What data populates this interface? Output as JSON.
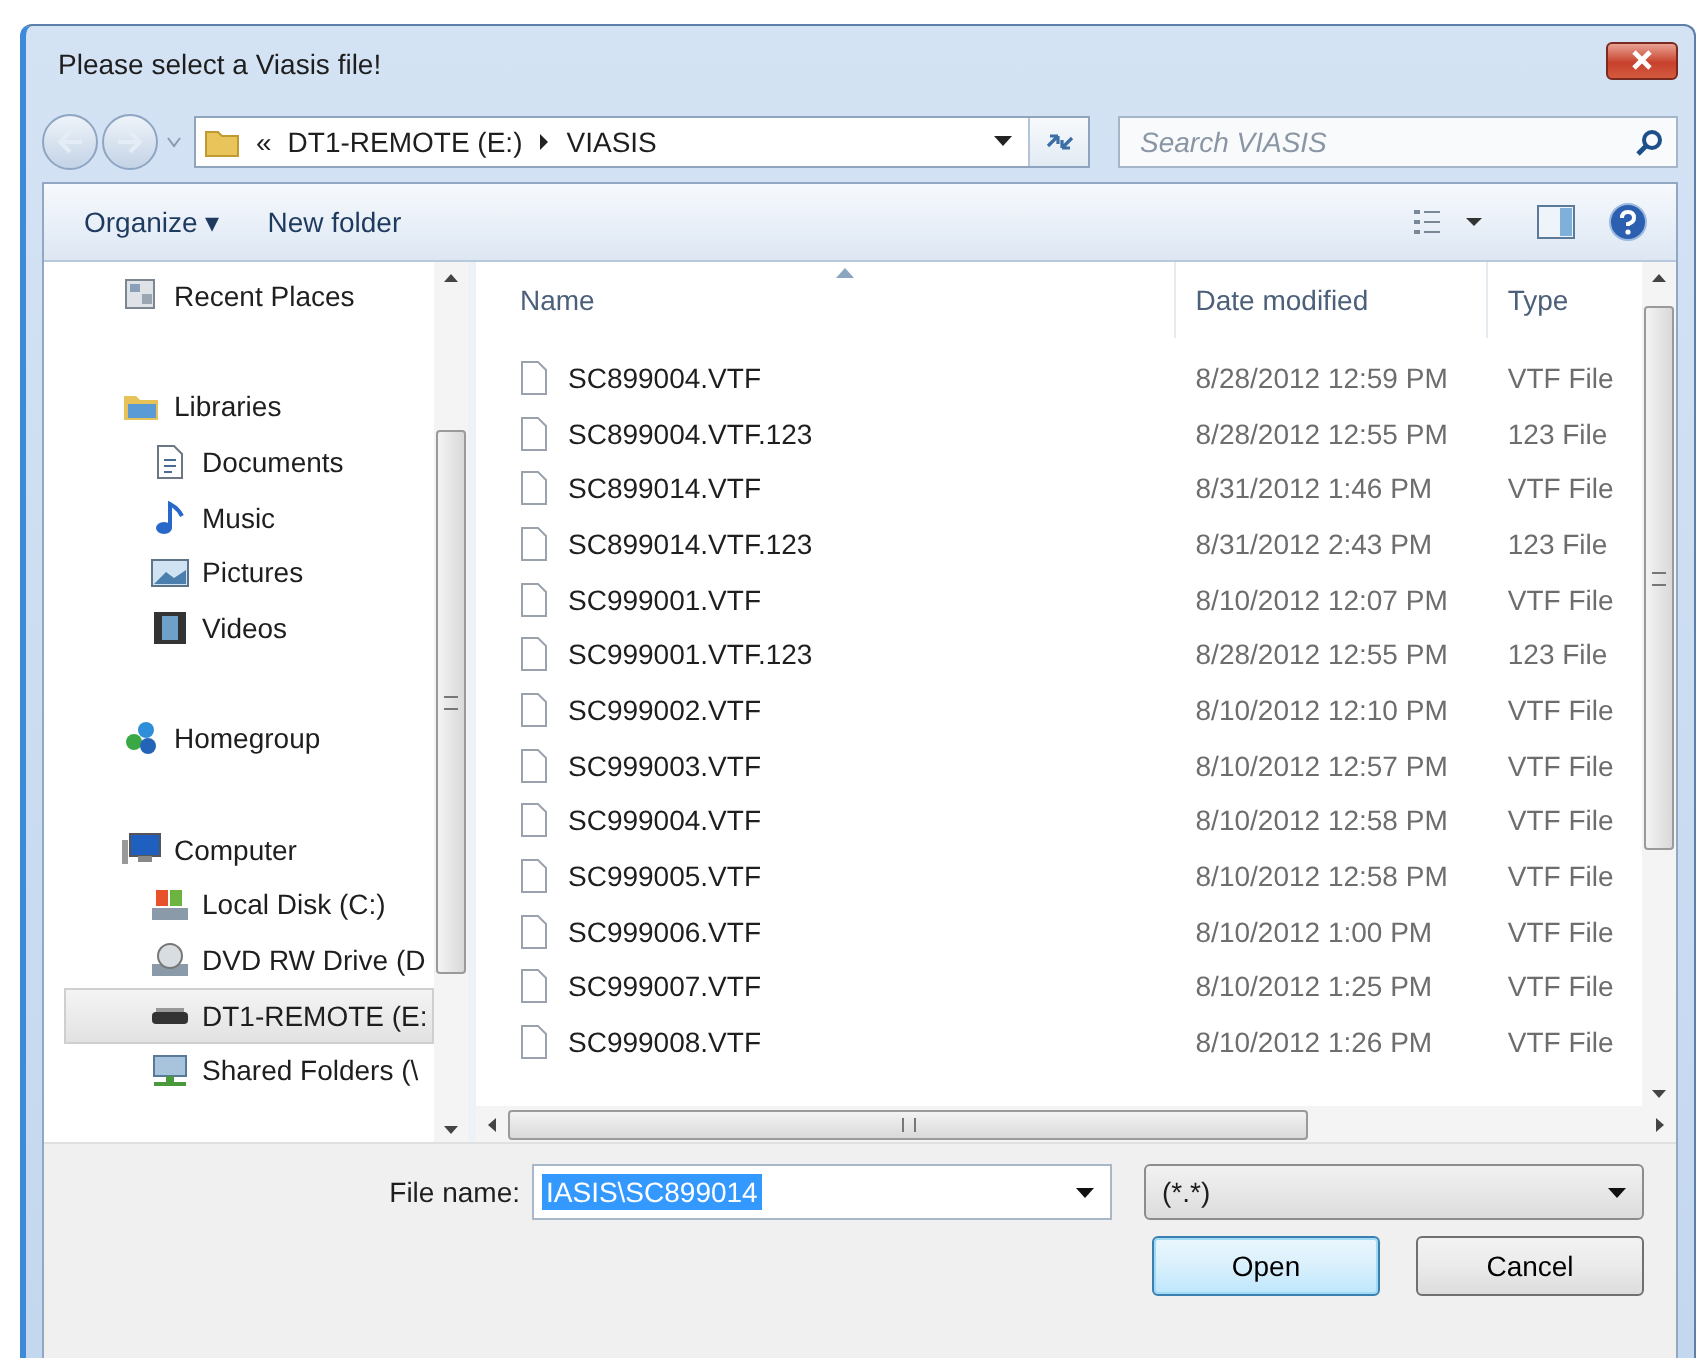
{
  "window": {
    "title": "Please select a Viasis file!"
  },
  "address": {
    "crumbs": [
      "«",
      "DT1-REMOTE (E:)",
      "VIASIS"
    ]
  },
  "search": {
    "placeholder": "Search VIASIS"
  },
  "toolbar": {
    "items": [
      "Organize ▾",
      "New folder"
    ]
  },
  "sidebar": {
    "items": [
      {
        "label": "Recent Places",
        "kind": "recent",
        "selected": false
      },
      {
        "label": "Libraries",
        "kind": "library",
        "selected": false,
        "children": [
          {
            "label": "Documents",
            "kind": "document",
            "selected": false
          },
          {
            "label": "Music",
            "kind": "music",
            "selected": false
          },
          {
            "label": "Pictures",
            "kind": "pictures",
            "selected": false
          },
          {
            "label": "Videos",
            "kind": "videos",
            "selected": false
          }
        ]
      },
      {
        "label": "Homegroup",
        "kind": "homegroup",
        "selected": false
      },
      {
        "label": "Computer",
        "kind": "computer",
        "selected": false,
        "children": [
          {
            "label": "Local Disk (C:)",
            "kind": "disk",
            "selected": false
          },
          {
            "label": "DVD RW Drive (D",
            "kind": "dvd",
            "selected": false
          },
          {
            "label": "DT1-REMOTE (E:",
            "kind": "drive",
            "selected": true
          },
          {
            "label": "Shared Folders (\\",
            "kind": "share",
            "selected": false
          }
        ]
      }
    ]
  },
  "table": {
    "columns": [
      {
        "label": "Name",
        "sorted": true
      },
      {
        "label": "Date modified",
        "sorted": false
      },
      {
        "label": "Type",
        "sorted": false
      }
    ],
    "rows": [
      {
        "name": "SC899004.VTF",
        "date": "8/28/2012 12:59 PM",
        "type": "VTF File"
      },
      {
        "name": "SC899004.VTF.123",
        "date": "8/28/2012 12:55 PM",
        "type": "123 File"
      },
      {
        "name": "SC899014.VTF",
        "date": "8/31/2012 1:46 PM",
        "type": "VTF File"
      },
      {
        "name": "SC899014.VTF.123",
        "date": "8/31/2012 2:43 PM",
        "type": "123 File"
      },
      {
        "name": "SC999001.VTF",
        "date": "8/10/2012 12:07 PM",
        "type": "VTF File"
      },
      {
        "name": "SC999001.VTF.123",
        "date": "8/28/2012 12:55 PM",
        "type": "123 File"
      },
      {
        "name": "SC999002.VTF",
        "date": "8/10/2012 12:10 PM",
        "type": "VTF File"
      },
      {
        "name": "SC999003.VTF",
        "date": "8/10/2012 12:57 PM",
        "type": "VTF File"
      },
      {
        "name": "SC999004.VTF",
        "date": "8/10/2012 12:58 PM",
        "type": "VTF File"
      },
      {
        "name": "SC999005.VTF",
        "date": "8/10/2012 12:58 PM",
        "type": "VTF File"
      },
      {
        "name": "SC999006.VTF",
        "date": "8/10/2012 1:00 PM",
        "type": "VTF File"
      },
      {
        "name": "SC999007.VTF",
        "date": "8/10/2012 1:25 PM",
        "type": "VTF File"
      },
      {
        "name": "SC999008.VTF",
        "date": "8/10/2012 1:26 PM",
        "type": "VTF File"
      }
    ]
  },
  "file_name": {
    "label": "File name:",
    "value": "IASIS\\SC899014",
    "text_selected": true
  },
  "file_type": {
    "value": "(*.*)"
  },
  "buttons": [
    {
      "label": "Open",
      "default": true
    },
    {
      "label": "Cancel",
      "default": false
    }
  ]
}
